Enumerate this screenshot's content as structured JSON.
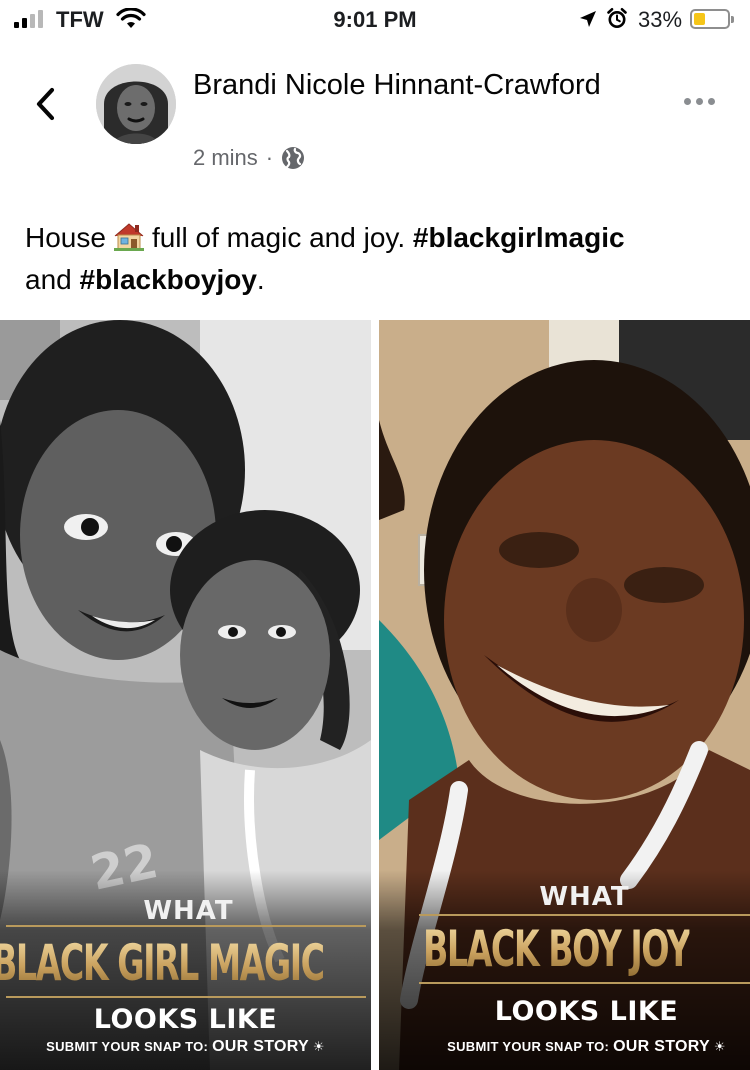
{
  "status_bar": {
    "carrier": "TFW",
    "time": "9:01 PM",
    "battery_percent_label": "33%",
    "battery_level": 0.33,
    "signal_bars_active": 2,
    "signal_bars_total": 4
  },
  "post": {
    "author": "Brandi Nicole Hinnant-Crawford",
    "timestamp": "2 mins",
    "separator": "·",
    "privacy_icon": "globe-icon",
    "text_part1": "House",
    "emoji": "house-emoji",
    "text_part2": "full of magic and joy.",
    "hashtag1": "#blackgirlmagic",
    "text_part3": "and",
    "hashtag2": "#blackboyjoy",
    "text_part4": "."
  },
  "photos": [
    {
      "what": "WHAT",
      "headline": "BLACK GIRL MAGIC",
      "looks_like": "LOOKS LIKE",
      "submit_prefix": "SUBMIT YOUR SNAP TO:",
      "submit_target": "OUR STORY",
      "jersey_text": "22"
    },
    {
      "what": "WHAT",
      "headline": "BLACK BOY JOY",
      "looks_like": "LOOKS LIKE",
      "submit_prefix": "SUBMIT YOUR SNAP TO:",
      "submit_target": "OUR STORY"
    }
  ],
  "colors": {
    "accent_gold": "#caa25f",
    "meta_gray": "#65676b",
    "battery_yellow": "#f5c518"
  }
}
